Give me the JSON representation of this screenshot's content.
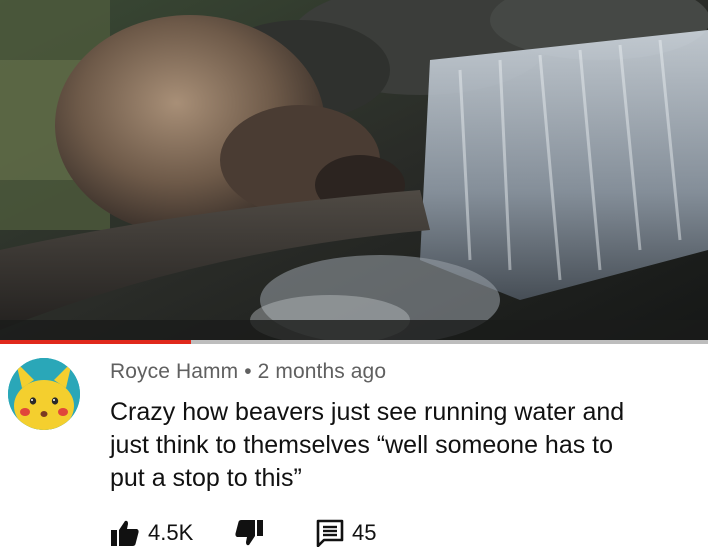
{
  "video": {
    "progress_fraction": 0.27
  },
  "comment": {
    "author": "Royce Hamm",
    "separator": "•",
    "time": "2 months ago",
    "text_lines": [
      "Crazy how beavers just see running water and",
      "just think to themselves “well someone has to",
      "put a stop to this”"
    ],
    "likes": "4.5K",
    "replies": "45"
  },
  "icons": {
    "like": "thumbs-up-icon",
    "dislike": "thumbs-down-icon",
    "reply": "comment-icon"
  },
  "colors": {
    "progress": "#e0291c",
    "meta_text": "#606060",
    "body_text": "#111111",
    "avatar_bg": "#2aa7b8"
  }
}
